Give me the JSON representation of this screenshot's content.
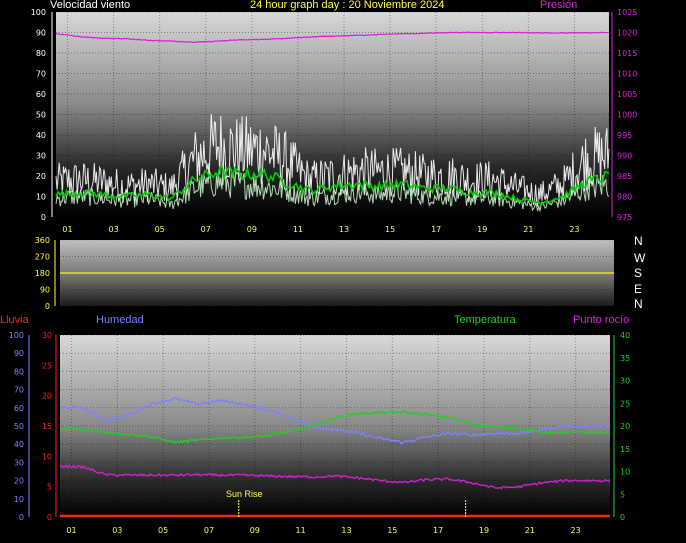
{
  "header": {
    "left_title": "Velocidad viento",
    "center_title": "24 hour graph day : 20 Noviembre 2024",
    "right_title": "Presión"
  },
  "direction_labels": [
    "N",
    "W",
    "S",
    "E",
    "N"
  ],
  "bottom_legend": {
    "rain": "Lluvia",
    "humidity": "Humedad",
    "temperature": "Temperatura",
    "dewpoint": "Punto rocío"
  },
  "annotation": {
    "sunrise": "Sun Rise"
  },
  "colors": {
    "wind_gust": "#ffffff",
    "wind_avg": "#c8f0c8",
    "wind_mean": "#00cc00",
    "pressure": "#e020e0",
    "direction": "#e8e020",
    "humidity": "#8080ff",
    "temperature": "#20d020",
    "dewpoint": "#d020d0",
    "rain": "#ff2020",
    "axis_left": "#ffffff",
    "axis_right_magenta": "#e020e0",
    "axis_right_green": "#20d020",
    "x_ticks": "#ffff40"
  },
  "chart_data": [
    {
      "type": "line",
      "title": "24 hour graph day : 20 Noviembre 2024",
      "x_ticks": [
        "01",
        "03",
        "05",
        "07",
        "09",
        "11",
        "13",
        "15",
        "17",
        "19",
        "21",
        "23"
      ],
      "x_range_hours": [
        0,
        24
      ],
      "y_left": {
        "label": "Velocidad viento",
        "range": [
          0,
          100
        ],
        "ticks": [
          "0",
          "10",
          "20",
          "30",
          "40",
          "50",
          "60",
          "70",
          "80",
          "90",
          "100"
        ]
      },
      "y_right": {
        "label": "Presión",
        "range": [
          975,
          1025
        ],
        "ticks": [
          "975",
          "980",
          "985",
          "990",
          "995",
          "1000",
          "1005",
          "1010",
          "1015",
          "1020",
          "1025"
        ]
      },
      "series": [
        {
          "name": "Presión",
          "axis": "right",
          "x": [
            0,
            1,
            2,
            3,
            4,
            5,
            6,
            7,
            8,
            9,
            10,
            11,
            12,
            13,
            14,
            15,
            16,
            17,
            18,
            19,
            20,
            21,
            22,
            23,
            24
          ],
          "values": [
            1019.7,
            1019.0,
            1018.6,
            1018.5,
            1018.1,
            1017.9,
            1017.6,
            1017.9,
            1018.2,
            1018.3,
            1018.6,
            1018.9,
            1019.1,
            1019.3,
            1019.5,
            1019.7,
            1019.8,
            1020.0,
            1020.0,
            1020.0,
            1020.0,
            1019.9,
            1019.9,
            1019.9,
            1020.0
          ]
        },
        {
          "name": "wind gust",
          "axis": "left",
          "x": [
            0,
            1,
            2,
            3,
            4,
            5,
            6,
            7,
            8,
            9,
            10,
            11,
            12,
            13,
            14,
            15,
            16,
            17,
            18,
            19,
            20,
            21,
            22,
            23,
            24
          ],
          "values": [
            17,
            18,
            17,
            15,
            16,
            14,
            28,
            35,
            32,
            33,
            27,
            18,
            20,
            22,
            22,
            22,
            20,
            20,
            18,
            18,
            14,
            11,
            16,
            28,
            30
          ]
        },
        {
          "name": "wind average",
          "axis": "left",
          "x": [
            0,
            1,
            2,
            3,
            4,
            5,
            6,
            7,
            8,
            9,
            10,
            11,
            12,
            13,
            14,
            15,
            16,
            17,
            18,
            19,
            20,
            21,
            22,
            23,
            24
          ],
          "values": [
            9,
            10,
            9,
            8,
            9,
            6,
            14,
            17,
            16,
            15,
            13,
            9,
            11,
            12,
            11,
            12,
            10,
            10,
            9,
            9,
            7,
            5,
            8,
            14,
            16
          ]
        },
        {
          "name": "wind mean",
          "axis": "left",
          "x": [
            0,
            1,
            2,
            3,
            4,
            5,
            6,
            7,
            8,
            9,
            10,
            11,
            12,
            13,
            14,
            15,
            16,
            17,
            18,
            19,
            20,
            21,
            22,
            23,
            24
          ],
          "values": [
            11,
            12,
            11,
            10,
            11,
            9,
            18,
            22,
            21,
            21,
            17,
            13,
            15,
            16,
            15,
            16,
            14,
            14,
            12,
            12,
            9,
            7,
            10,
            17,
            20
          ]
        }
      ]
    },
    {
      "type": "line",
      "y_left": {
        "range": [
          0,
          360
        ],
        "ticks": [
          "0",
          "90",
          "180",
          "270",
          "360"
        ]
      },
      "series": [
        {
          "name": "wind direction",
          "x": [
            0,
            24
          ],
          "values": [
            180,
            180
          ]
        }
      ]
    },
    {
      "type": "line",
      "x_ticks": [
        "01",
        "03",
        "05",
        "07",
        "09",
        "11",
        "13",
        "15",
        "17",
        "19",
        "21",
        "23"
      ],
      "x_range_hours": [
        0,
        24
      ],
      "y_left_rain": {
        "label": "Lluvia",
        "range": [
          0,
          30
        ],
        "ticks": [
          "0",
          "5",
          "10",
          "15",
          "20",
          "25",
          "30"
        ]
      },
      "y_left_humidity": {
        "label": "Humedad",
        "range": [
          0,
          100
        ],
        "ticks": [
          "0",
          "10",
          "20",
          "30",
          "40",
          "50",
          "60",
          "70",
          "80",
          "90",
          "100"
        ]
      },
      "y_right": {
        "label": "Temperatura",
        "range": [
          0,
          40
        ],
        "ticks": [
          "0",
          "5",
          "10",
          "15",
          "20",
          "25",
          "30",
          "35",
          "40"
        ]
      },
      "series": [
        {
          "name": "Humedad",
          "axis": "humidity",
          "x": [
            0,
            1,
            2,
            3,
            4,
            5,
            6,
            7,
            8,
            9,
            10,
            11,
            12,
            13,
            14,
            15,
            16,
            17,
            18,
            19,
            20,
            21,
            22,
            23,
            24
          ],
          "values": [
            60,
            60,
            53,
            56,
            62,
            65,
            62,
            64,
            62,
            59,
            55,
            50,
            48,
            46,
            43,
            41,
            44,
            46,
            45,
            46,
            46,
            48,
            50,
            50,
            50
          ]
        },
        {
          "name": "Temperatura",
          "axis": "right",
          "x": [
            0,
            1,
            2,
            3,
            4,
            5,
            6,
            7,
            8,
            9,
            10,
            11,
            12,
            13,
            14,
            15,
            16,
            17,
            18,
            19,
            20,
            21,
            22,
            23,
            24
          ],
          "values": [
            19.3,
            19.2,
            18.6,
            18.2,
            17.6,
            16.4,
            16.9,
            17.4,
            17.5,
            17.8,
            18.8,
            20.0,
            21.8,
            22.8,
            22.9,
            23.0,
            22.5,
            21.8,
            20.4,
            19.8,
            19.5,
            18.6,
            18.5,
            18.7,
            18.6
          ]
        },
        {
          "name": "Punto rocío",
          "axis": "right",
          "x": [
            0,
            1,
            2,
            3,
            4,
            5,
            6,
            7,
            8,
            9,
            10,
            11,
            12,
            13,
            14,
            15,
            16,
            17,
            18,
            19,
            20,
            21,
            22,
            23,
            24
          ],
          "values": [
            11.2,
            11.0,
            9.3,
            9.2,
            9.2,
            9.2,
            9.3,
            9.2,
            9.2,
            9.0,
            8.9,
            8.8,
            9.0,
            8.6,
            8.0,
            7.6,
            8.2,
            8.3,
            7.5,
            6.4,
            6.6,
            7.5,
            8.0,
            8.0,
            8.0
          ]
        },
        {
          "name": "Lluvia",
          "axis": "rain",
          "x": [
            0,
            24
          ],
          "values": [
            0,
            0
          ]
        }
      ],
      "markers": [
        {
          "label": "Sun Rise",
          "x": 7.8
        },
        {
          "label": "",
          "x": 17.7
        }
      ]
    }
  ]
}
